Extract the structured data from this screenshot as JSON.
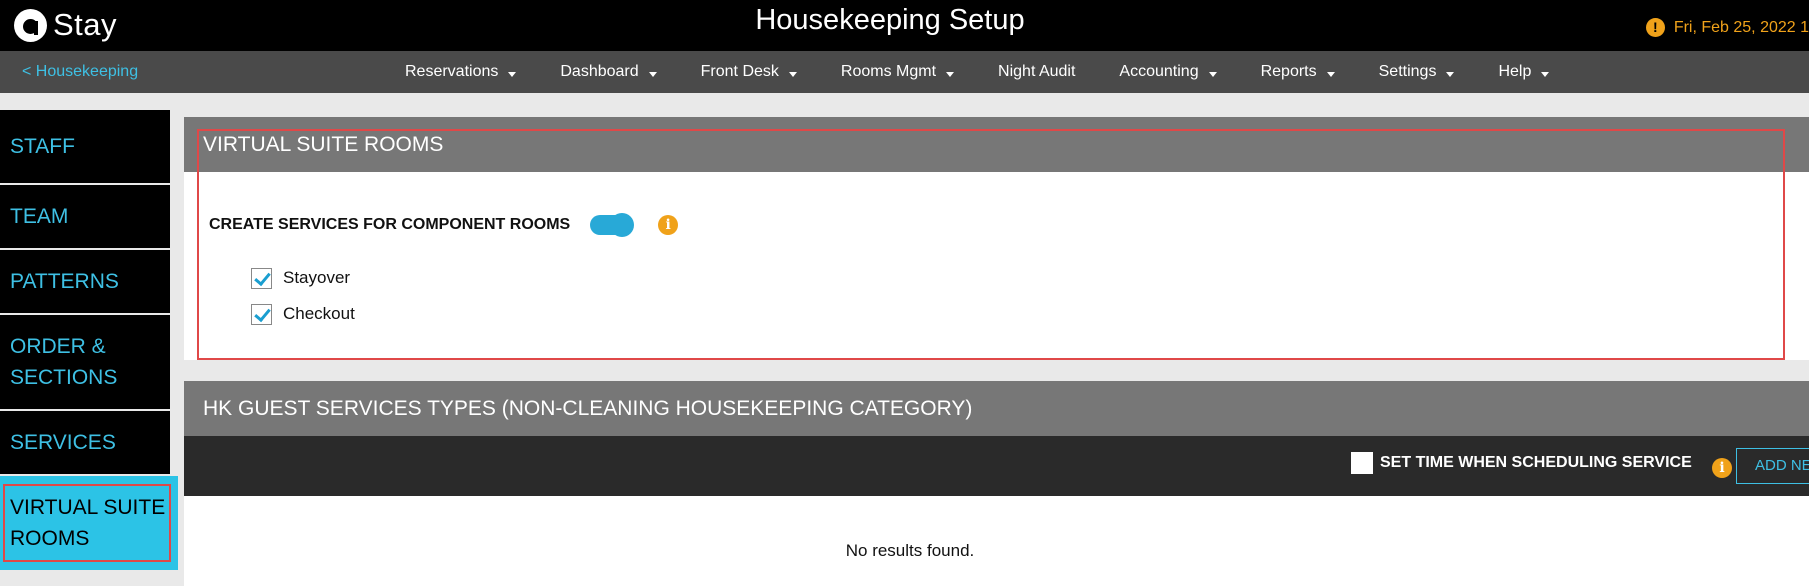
{
  "brand": {
    "name": "Stay"
  },
  "header": {
    "title": "Housekeeping Setup",
    "date": "Fri, Feb 25, 2022 1"
  },
  "nav": {
    "back": "< Housekeeping",
    "items": [
      {
        "label": "Reservations",
        "dropdown": true
      },
      {
        "label": "Dashboard",
        "dropdown": true
      },
      {
        "label": "Front Desk",
        "dropdown": true
      },
      {
        "label": "Rooms Mgmt",
        "dropdown": true
      },
      {
        "label": "Night Audit",
        "dropdown": false
      },
      {
        "label": "Accounting",
        "dropdown": true
      },
      {
        "label": "Reports",
        "dropdown": true
      },
      {
        "label": "Settings",
        "dropdown": true
      },
      {
        "label": "Help",
        "dropdown": true
      }
    ]
  },
  "sidebar": {
    "items": [
      {
        "label": "STAFF"
      },
      {
        "label": "TEAM"
      },
      {
        "label": "PATTERNS"
      },
      {
        "label": "ORDER & SECTIONS"
      },
      {
        "label": "SERVICES"
      },
      {
        "label": "VIRTUAL SUITE ROOMS"
      }
    ],
    "active_index": 5
  },
  "virtual_suite": {
    "title": "VIRTUAL SUITE ROOMS",
    "toggle_label": "CREATE SERVICES FOR COMPONENT ROOMS",
    "toggle_on": true,
    "checks": [
      {
        "label": "Stayover",
        "checked": true
      },
      {
        "label": "Checkout",
        "checked": true
      }
    ]
  },
  "guest_services": {
    "title": "HK GUEST SERVICES TYPES (NON-CLEANING HOUSEKEEPING CATEGORY)",
    "set_time_label": "SET TIME WHEN SCHEDULING SERVICE",
    "add_button": "ADD NE",
    "empty_text": "No results found."
  },
  "colors": {
    "accent": "#3ec0e4",
    "warning": "#f0a21a",
    "highlight": "#e04848"
  }
}
